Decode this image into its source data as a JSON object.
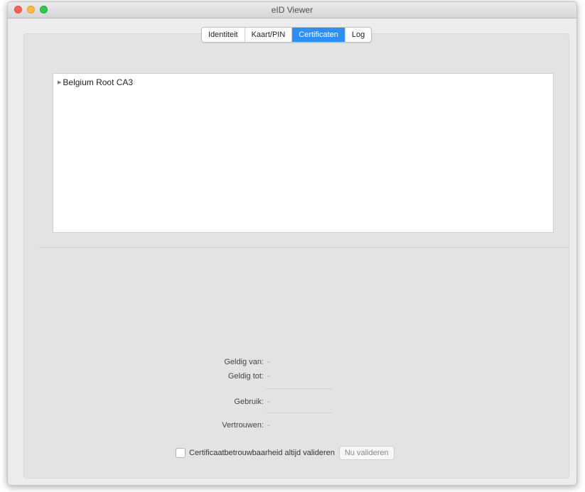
{
  "window": {
    "title": "eID Viewer"
  },
  "tabs": [
    {
      "label": "Identiteit",
      "active": false
    },
    {
      "label": "Kaart/PIN",
      "active": false
    },
    {
      "label": "Certificaten",
      "active": true
    },
    {
      "label": "Log",
      "active": false
    }
  ],
  "tree": {
    "items": [
      {
        "label": "Belgium Root CA3",
        "expanded": false
      }
    ]
  },
  "details": {
    "valid_from": {
      "label": "Geldig van:",
      "value": "-"
    },
    "valid_to": {
      "label": "Geldig tot:",
      "value": "-"
    },
    "usage": {
      "label": "Gebruik:",
      "value": "-"
    },
    "trust": {
      "label": "Vertrouwen:",
      "value": "-"
    }
  },
  "validation": {
    "checkbox_label": "Certificaatbetrouwbaarheid altijd valideren",
    "checked": false,
    "button_label": "Nu valideren"
  },
  "colors": {
    "accent": "#2f8ef6"
  }
}
